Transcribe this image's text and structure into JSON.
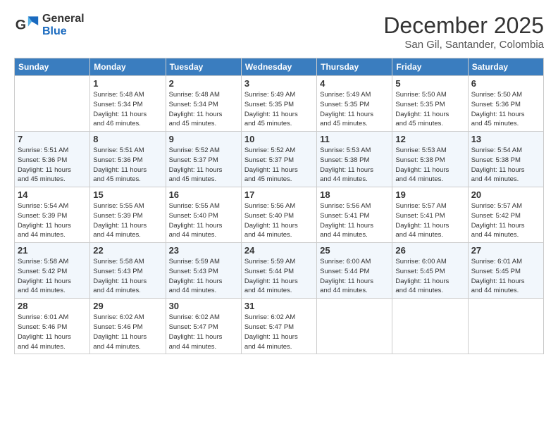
{
  "header": {
    "logo_general": "General",
    "logo_blue": "Blue",
    "month_year": "December 2025",
    "location": "San Gil, Santander, Colombia"
  },
  "days_of_week": [
    "Sunday",
    "Monday",
    "Tuesday",
    "Wednesday",
    "Thursday",
    "Friday",
    "Saturday"
  ],
  "weeks": [
    [
      {
        "day": "",
        "info": ""
      },
      {
        "day": "1",
        "info": "Sunrise: 5:48 AM\nSunset: 5:34 PM\nDaylight: 11 hours\nand 46 minutes."
      },
      {
        "day": "2",
        "info": "Sunrise: 5:48 AM\nSunset: 5:34 PM\nDaylight: 11 hours\nand 45 minutes."
      },
      {
        "day": "3",
        "info": "Sunrise: 5:49 AM\nSunset: 5:35 PM\nDaylight: 11 hours\nand 45 minutes."
      },
      {
        "day": "4",
        "info": "Sunrise: 5:49 AM\nSunset: 5:35 PM\nDaylight: 11 hours\nand 45 minutes."
      },
      {
        "day": "5",
        "info": "Sunrise: 5:50 AM\nSunset: 5:35 PM\nDaylight: 11 hours\nand 45 minutes."
      },
      {
        "day": "6",
        "info": "Sunrise: 5:50 AM\nSunset: 5:36 PM\nDaylight: 11 hours\nand 45 minutes."
      }
    ],
    [
      {
        "day": "7",
        "info": "Sunrise: 5:51 AM\nSunset: 5:36 PM\nDaylight: 11 hours\nand 45 minutes."
      },
      {
        "day": "8",
        "info": "Sunrise: 5:51 AM\nSunset: 5:36 PM\nDaylight: 11 hours\nand 45 minutes."
      },
      {
        "day": "9",
        "info": "Sunrise: 5:52 AM\nSunset: 5:37 PM\nDaylight: 11 hours\nand 45 minutes."
      },
      {
        "day": "10",
        "info": "Sunrise: 5:52 AM\nSunset: 5:37 PM\nDaylight: 11 hours\nand 45 minutes."
      },
      {
        "day": "11",
        "info": "Sunrise: 5:53 AM\nSunset: 5:38 PM\nDaylight: 11 hours\nand 44 minutes."
      },
      {
        "day": "12",
        "info": "Sunrise: 5:53 AM\nSunset: 5:38 PM\nDaylight: 11 hours\nand 44 minutes."
      },
      {
        "day": "13",
        "info": "Sunrise: 5:54 AM\nSunset: 5:38 PM\nDaylight: 11 hours\nand 44 minutes."
      }
    ],
    [
      {
        "day": "14",
        "info": "Sunrise: 5:54 AM\nSunset: 5:39 PM\nDaylight: 11 hours\nand 44 minutes."
      },
      {
        "day": "15",
        "info": "Sunrise: 5:55 AM\nSunset: 5:39 PM\nDaylight: 11 hours\nand 44 minutes."
      },
      {
        "day": "16",
        "info": "Sunrise: 5:55 AM\nSunset: 5:40 PM\nDaylight: 11 hours\nand 44 minutes."
      },
      {
        "day": "17",
        "info": "Sunrise: 5:56 AM\nSunset: 5:40 PM\nDaylight: 11 hours\nand 44 minutes."
      },
      {
        "day": "18",
        "info": "Sunrise: 5:56 AM\nSunset: 5:41 PM\nDaylight: 11 hours\nand 44 minutes."
      },
      {
        "day": "19",
        "info": "Sunrise: 5:57 AM\nSunset: 5:41 PM\nDaylight: 11 hours\nand 44 minutes."
      },
      {
        "day": "20",
        "info": "Sunrise: 5:57 AM\nSunset: 5:42 PM\nDaylight: 11 hours\nand 44 minutes."
      }
    ],
    [
      {
        "day": "21",
        "info": "Sunrise: 5:58 AM\nSunset: 5:42 PM\nDaylight: 11 hours\nand 44 minutes."
      },
      {
        "day": "22",
        "info": "Sunrise: 5:58 AM\nSunset: 5:43 PM\nDaylight: 11 hours\nand 44 minutes."
      },
      {
        "day": "23",
        "info": "Sunrise: 5:59 AM\nSunset: 5:43 PM\nDaylight: 11 hours\nand 44 minutes."
      },
      {
        "day": "24",
        "info": "Sunrise: 5:59 AM\nSunset: 5:44 PM\nDaylight: 11 hours\nand 44 minutes."
      },
      {
        "day": "25",
        "info": "Sunrise: 6:00 AM\nSunset: 5:44 PM\nDaylight: 11 hours\nand 44 minutes."
      },
      {
        "day": "26",
        "info": "Sunrise: 6:00 AM\nSunset: 5:45 PM\nDaylight: 11 hours\nand 44 minutes."
      },
      {
        "day": "27",
        "info": "Sunrise: 6:01 AM\nSunset: 5:45 PM\nDaylight: 11 hours\nand 44 minutes."
      }
    ],
    [
      {
        "day": "28",
        "info": "Sunrise: 6:01 AM\nSunset: 5:46 PM\nDaylight: 11 hours\nand 44 minutes."
      },
      {
        "day": "29",
        "info": "Sunrise: 6:02 AM\nSunset: 5:46 PM\nDaylight: 11 hours\nand 44 minutes."
      },
      {
        "day": "30",
        "info": "Sunrise: 6:02 AM\nSunset: 5:47 PM\nDaylight: 11 hours\nand 44 minutes."
      },
      {
        "day": "31",
        "info": "Sunrise: 6:02 AM\nSunset: 5:47 PM\nDaylight: 11 hours\nand 44 minutes."
      },
      {
        "day": "",
        "info": ""
      },
      {
        "day": "",
        "info": ""
      },
      {
        "day": "",
        "info": ""
      }
    ]
  ]
}
